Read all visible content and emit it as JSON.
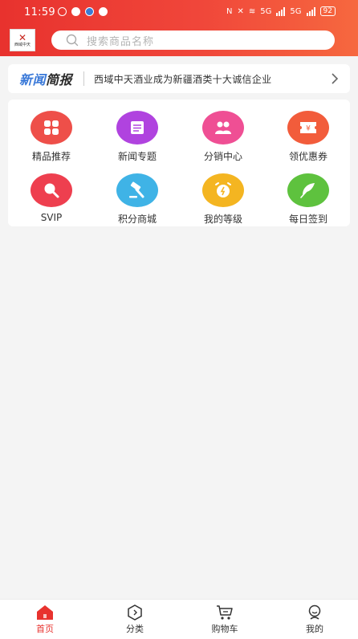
{
  "status_bar": {
    "time": "11:59",
    "network_tags": [
      "5G",
      "5G"
    ],
    "battery": "92"
  },
  "header": {
    "logo_text": "西域中天",
    "search_placeholder": "搜索商品名称"
  },
  "news": {
    "tag_part1": "新闻",
    "tag_part2": "简报",
    "headline": "西域中天酒业成为新疆酒类十大诚信企业"
  },
  "menu": [
    {
      "label": "精品推荐",
      "icon": "grid-icon",
      "color": "#ee4f49"
    },
    {
      "label": "新闻专题",
      "icon": "newspaper-icon",
      "color": "#b043df"
    },
    {
      "label": "分销中心",
      "icon": "users-icon",
      "color": "#ef4f94"
    },
    {
      "label": "领优惠券",
      "icon": "coupon-icon",
      "color": "#f25c3b"
    },
    {
      "label": "SVIP",
      "icon": "magnifier-icon",
      "color": "#ee3f4f"
    },
    {
      "label": "积分商城",
      "icon": "hammer-icon",
      "color": "#3fb3e6"
    },
    {
      "label": "我的等级",
      "icon": "alarm-icon",
      "color": "#f4b521"
    },
    {
      "label": "每日签到",
      "icon": "feather-icon",
      "color": "#5ec23e"
    }
  ],
  "bottom_nav": [
    {
      "label": "首页",
      "icon": "home-icon",
      "active": true
    },
    {
      "label": "分类",
      "icon": "category-icon",
      "active": false
    },
    {
      "label": "购物车",
      "icon": "cart-icon",
      "active": false
    },
    {
      "label": "我的",
      "icon": "profile-icon",
      "active": false
    }
  ],
  "colors": {
    "brand_red": "#e8322e",
    "news_blue": "#3a79d8"
  }
}
